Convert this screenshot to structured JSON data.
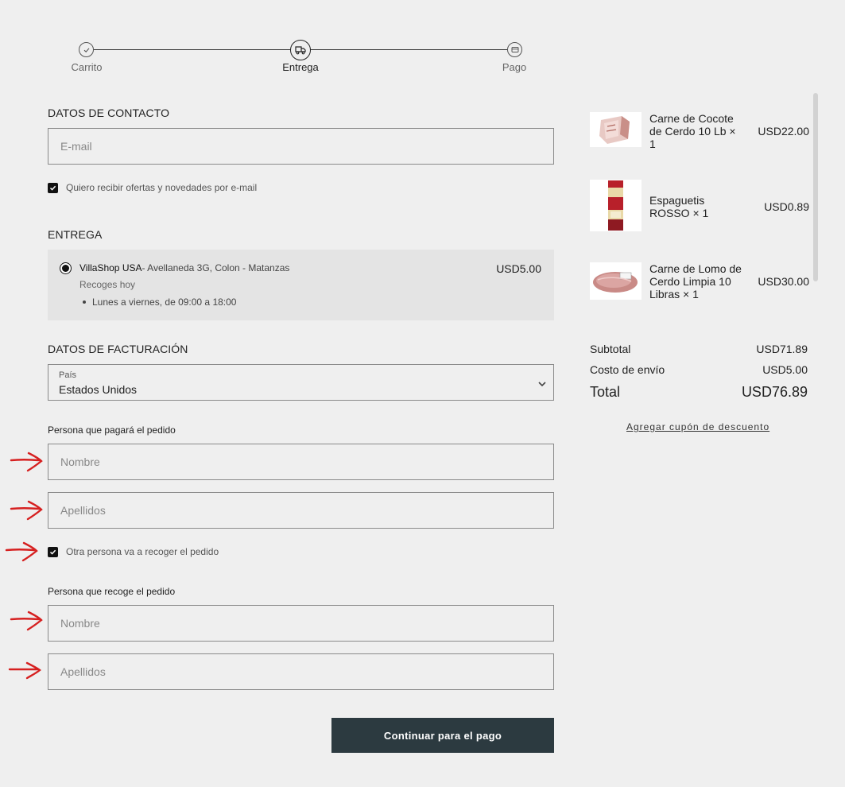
{
  "stepper": {
    "steps": [
      {
        "label": "Carrito",
        "state": "done"
      },
      {
        "label": "Entrega",
        "state": "active"
      },
      {
        "label": "Pago",
        "state": "pending"
      }
    ]
  },
  "contact": {
    "title": "DATOS DE CONTACTO",
    "email_placeholder": "E-mail",
    "newsletter_label": "Quiero recibir ofertas y novedades por e-mail",
    "newsletter_checked": true
  },
  "delivery": {
    "title": "ENTREGA",
    "option": {
      "store": "VillaShop USA",
      "address": "- Avellaneda 3G, Colon - Matanzas",
      "price": "USD5.00",
      "subtitle": "Recoges hoy",
      "hours": "Lunes a viernes, de 09:00 a 18:00",
      "selected": true
    }
  },
  "billing": {
    "title": "DATOS DE FACTURACIÓN",
    "country_label": "País",
    "country_value": "Estados Unidos",
    "payer_title": "Persona que pagará el pedido",
    "payer_first_placeholder": "Nombre",
    "payer_last_placeholder": "Apellidos",
    "other_person_label": "Otra persona va a recoger el pedido",
    "other_person_checked": true,
    "pickup_title": "Persona que recoge el pedido",
    "pickup_first_placeholder": "Nombre",
    "pickup_last_placeholder": "Apellidos"
  },
  "actions": {
    "continue_label": "Continuar para el pago"
  },
  "cart": {
    "items": [
      {
        "name": "Carne de Cocote de Cerdo 10 Lb × 1",
        "price": "USD22.00",
        "icon": "pork-cut-thumb"
      },
      {
        "name": "Espaguetis ROSSO × 1",
        "price": "USD0.89",
        "icon": "spaghetti-pack-thumb"
      },
      {
        "name": "Carne de Lomo de Cerdo Limpia 10 Libras × 1",
        "price": "USD30.00",
        "icon": "pork-loin-thumb"
      }
    ]
  },
  "summary": {
    "subtotal_label": "Subtotal",
    "subtotal_value": "USD71.89",
    "shipping_label": "Costo de envío",
    "shipping_value": "USD5.00",
    "total_label": "Total",
    "total_value": "USD76.89",
    "coupon_label": "Agregar cupón de descuento"
  },
  "colors": {
    "background": "#efefef",
    "button": "#2c3a40",
    "annotation_arrow": "#d62020"
  }
}
